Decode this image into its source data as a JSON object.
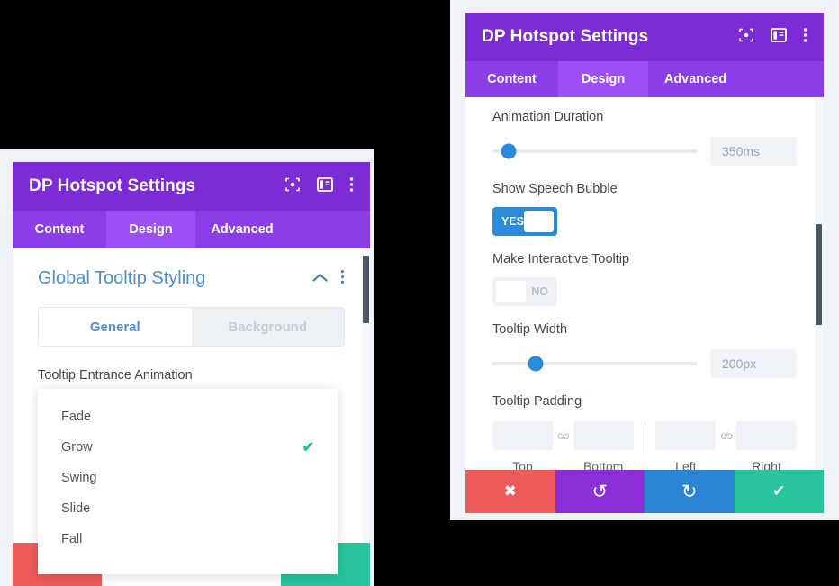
{
  "colors": {
    "page_background": "#000000",
    "header_purple": "#7b2cd4",
    "tabbar_purple": "#8b3ee8",
    "tab_active_purple": "#9b4ff5",
    "section_title_blue": "#4c8fd0",
    "slider_blue": "#2a8bdb",
    "toggle_on_blue": "#2a8bdb",
    "check_green": "#27c08a",
    "action_close_red": "#ed5a5a",
    "action_undo_purple": "#8b2fd6",
    "action_redo_blue": "#2a85d4",
    "action_save_teal": "#28c59c",
    "scrollbar_thumb": "#4a5763"
  },
  "left_panel": {
    "header": {
      "title": "DP Hotspot Settings",
      "icons": [
        "focus-target-icon",
        "panel-layout-icon",
        "overflow-menu-icon"
      ]
    },
    "tabs": [
      {
        "label": "Content",
        "active": false
      },
      {
        "label": "Design",
        "active": true
      },
      {
        "label": "Advanced",
        "active": false
      }
    ],
    "section": {
      "title": "Global Tooltip Styling",
      "collapse_icon": "chevron-up-icon",
      "menu_icon": "overflow-menu-icon"
    },
    "segmented": [
      {
        "label": "General",
        "active": true
      },
      {
        "label": "Background",
        "active": false
      }
    ],
    "field_label": "Tooltip Entrance Animation",
    "dropdown": {
      "options": [
        {
          "label": "Fade",
          "selected": false
        },
        {
          "label": "Grow",
          "selected": true
        },
        {
          "label": "Swing",
          "selected": false
        },
        {
          "label": "Slide",
          "selected": false
        },
        {
          "label": "Fall",
          "selected": false
        }
      ],
      "check_glyph": "✔"
    }
  },
  "right_panel": {
    "header": {
      "title": "DP Hotspot Settings",
      "icons": [
        "focus-target-icon",
        "panel-layout-icon",
        "overflow-menu-icon"
      ]
    },
    "tabs": [
      {
        "label": "Content",
        "active": false
      },
      {
        "label": "Design",
        "active": true
      },
      {
        "label": "Advanced",
        "active": false
      }
    ],
    "fields": {
      "animation_duration": {
        "label": "Animation Duration",
        "value": "350ms",
        "knob_percent": 8
      },
      "show_speech_bubble": {
        "label": "Show Speech Bubble",
        "state": "YES",
        "on": true
      },
      "make_interactive_tooltip": {
        "label": "Make Interactive Tooltip",
        "state": "NO",
        "on": false
      },
      "tooltip_width": {
        "label": "Tooltip Width",
        "value": "200px",
        "knob_percent": 21
      },
      "tooltip_padding": {
        "label": "Tooltip Padding",
        "link_glyph": "c/ɔ",
        "cells": [
          {
            "caption": "Top",
            "value": ""
          },
          {
            "caption": "Bottom",
            "value": ""
          },
          {
            "caption": "Left",
            "value": ""
          },
          {
            "caption": "Right",
            "value": ""
          }
        ]
      }
    },
    "actions": [
      {
        "name": "cancel",
        "glyph": "✖"
      },
      {
        "name": "undo",
        "glyph": "↺"
      },
      {
        "name": "redo",
        "glyph": "↻"
      },
      {
        "name": "save",
        "glyph": "✔"
      }
    ]
  }
}
